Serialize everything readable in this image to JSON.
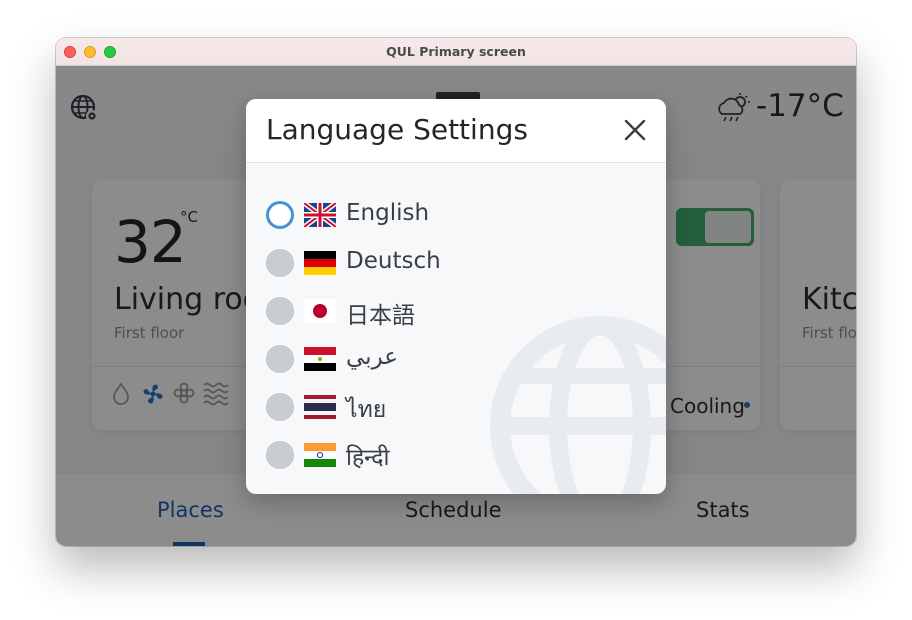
{
  "window": {
    "title": "QUL Primary screen"
  },
  "appbar": {
    "outside_temperature": "-17°C",
    "settings_icon": "globe-settings-icon",
    "weather_icon": "cloud-sun-rain-icon"
  },
  "cards": {
    "main": {
      "temperature": "32",
      "unit": "°C",
      "room": "Living room",
      "floor": "First floor"
    },
    "middle": {
      "mode_label": "Cooling",
      "toggle_on": true
    },
    "right": {
      "room": "Kitchen",
      "floor": "First floor"
    }
  },
  "nav": {
    "tabs": [
      {
        "label": "Places",
        "active": true
      },
      {
        "label": "Schedule"
      },
      {
        "label": "Stats"
      }
    ]
  },
  "dialog": {
    "title": "Language Settings",
    "close_icon": "close-icon",
    "languages": [
      {
        "label": "English",
        "flag": "uk-flag-icon",
        "selected": true
      },
      {
        "label": "Deutsch",
        "flag": "germany-flag-icon",
        "selected": false
      },
      {
        "label": "日本語",
        "flag": "japan-flag-icon",
        "selected": false
      },
      {
        "label": "عربي",
        "flag": "egypt-flag-icon",
        "selected": false
      },
      {
        "label": "ไทย",
        "flag": "thailand-flag-icon",
        "selected": false
      },
      {
        "label": "हिन्दी",
        "flag": "india-flag-icon",
        "selected": false
      }
    ]
  },
  "colors": {
    "accent": "#1d62b5",
    "radio_selected": "#4a90d9",
    "toggle": "#3fae6a"
  }
}
